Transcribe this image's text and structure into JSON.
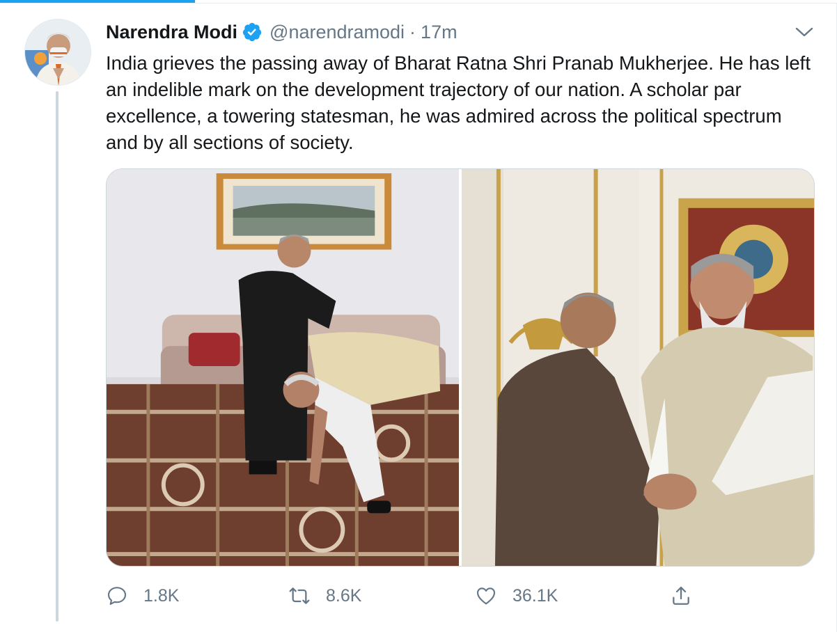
{
  "colors": {
    "accent": "#1da1f2",
    "text": "#14171a",
    "secondary": "#657786",
    "thread_line": "#ccd6dd"
  },
  "author": {
    "display_name": "Narendra Modi",
    "verified_icon": "verified-badge-icon",
    "handle": "@narendramodi",
    "separator": "·",
    "timestamp": "17m"
  },
  "tweet": {
    "text": "India grieves the passing away of Bharat Ratna Shri Pranab Mukherjee. He has left an indelible mark on the development trajectory of our nation. A scholar par excellence, a towering statesman, he was admired across the political spectrum and by all sections of society."
  },
  "actions": {
    "reply": {
      "icon": "reply-icon",
      "count": "1.8K"
    },
    "retweet": {
      "icon": "retweet-icon",
      "count": "8.6K"
    },
    "like": {
      "icon": "heart-icon",
      "count": "36.1K"
    },
    "share": {
      "icon": "share-icon"
    }
  }
}
